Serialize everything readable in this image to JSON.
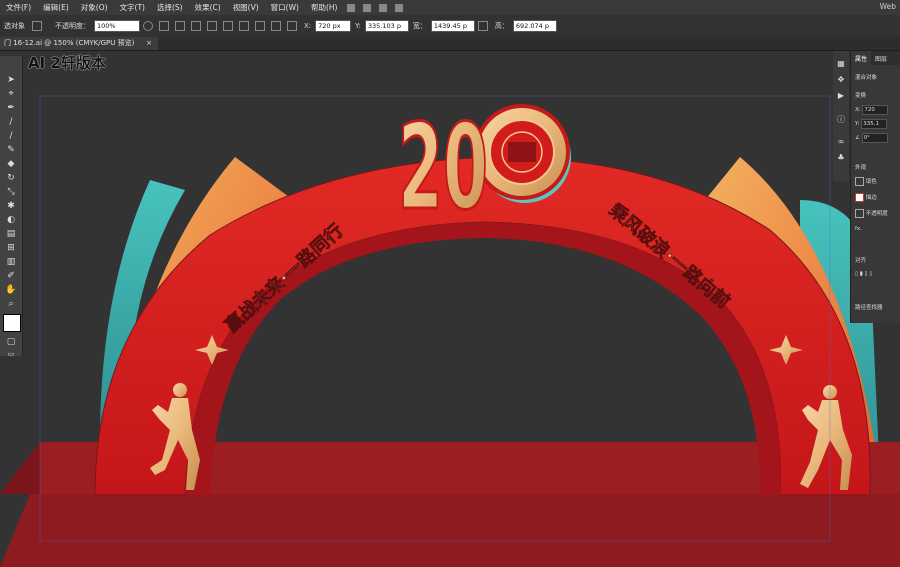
{
  "menu": {
    "items": [
      "文件(F)",
      "编辑(E)",
      "对象(O)",
      "文字(T)",
      "选择(S)",
      "效果(C)",
      "视图(V)",
      "窗口(W)",
      "帮助(H)"
    ],
    "workspace": "Web"
  },
  "control_bar": {
    "selection_label": "选对象",
    "opacity_label": "不透明度：",
    "opacity_value": "100%",
    "x_label": "X:",
    "x_value": "720 px",
    "y_label": "Y:",
    "y_value": "335.103 p",
    "w_label": "宽：",
    "w_value": "1439.45 p",
    "h_label": "高：",
    "h_value": "692.074 p"
  },
  "document_tab": {
    "title": "门 16-12.ai @ 150% (CMYK/GPU 预览)",
    "close": "×"
  },
  "watermark": "AI 2轩版本",
  "properties_panel": {
    "tabs": [
      "属性",
      "图层"
    ],
    "section_transform": "变换",
    "x_label": "X:",
    "x_value": "720",
    "y_label": "Y:",
    "y_value": "335.1",
    "angle_value": "0°",
    "section_appearance": "外观",
    "fill_label": "填色",
    "stroke_label": "描边",
    "opacity_label": "不透明度",
    "fx_label": "fx.",
    "section_align": "对齐",
    "section_pathfinder": "路径查找器",
    "mixed_label": "混合对象"
  },
  "artwork": {
    "logo_number": "20",
    "left_slogan": "赢战未来·一路同行",
    "right_slogan": "乘风破浪·一路向前",
    "colors": {
      "arch_red": "#d21c1c",
      "platform": "#9b1f22",
      "gold": "#e9b77a",
      "teal": "#3fb5b0",
      "orange": "#f2a453"
    }
  }
}
